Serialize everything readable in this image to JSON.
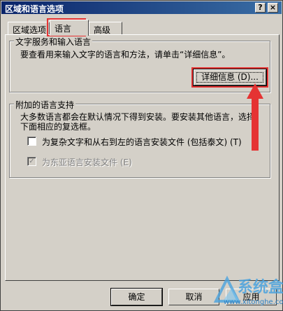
{
  "window": {
    "title": "区域和语言选项",
    "help_label": "?",
    "close_label": "×"
  },
  "tabs": [
    {
      "label": "区域选项"
    },
    {
      "label": "语言"
    },
    {
      "label": "高级"
    }
  ],
  "text_services": {
    "group_title": "文字服务和输入语言",
    "description": "要查看用来输入文字的语言和方法，请单击“详细信息”。",
    "details_button": "详细信息 (D)..."
  },
  "supplemental": {
    "group_title": "附加的语言支持",
    "description_line1": "大多数语言都会在默认情况下得到安装。要安装其他语言，选择",
    "description_line2": "下面相应的复选框。",
    "complex_script": {
      "label": "为复杂文字和从右到左的语言安装文件 (包括泰文) (T)",
      "checked": false
    },
    "east_asian": {
      "label": "为东亚语言安装文件 (E)",
      "checked": true,
      "disabled": true
    }
  },
  "footer": {
    "ok_label": "确定",
    "cancel_label": "取消",
    "apply_label": "应用"
  },
  "watermark": {
    "brand": "系统盒",
    "url": "www.xitonghe.com"
  },
  "colors": {
    "annotation_red": "#e53333",
    "titlebar_start": "#0a246a",
    "dialog_face": "#d4d0c8"
  }
}
